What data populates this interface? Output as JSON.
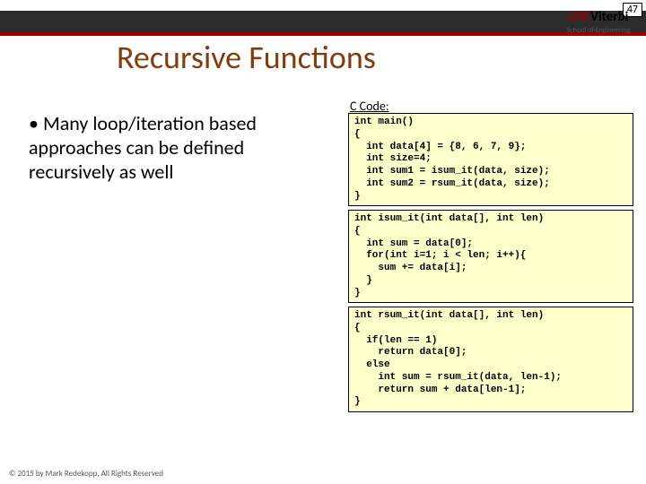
{
  "page_number": "47",
  "logo": {
    "usc": "USC",
    "viterbi": "Viterbi",
    "sub": "School of Engineering"
  },
  "title": "Recursive Functions",
  "bullet": "Many loop/iteration based approaches can be defined recursively as well",
  "code_label": "C Code:",
  "code1": "int main()\n{\n  int data[4] = {8, 6, 7, 9};\n  int size=4;\n  int sum1 = isum_it(data, size);\n  int sum2 = rsum_it(data, size);\n}",
  "code2": "int isum_it(int data[], int len)\n{\n  int sum = data[0];\n  for(int i=1; i < len; i++){\n    sum += data[i];\n  }\n}",
  "code3": "int rsum_it(int data[], int len)\n{\n  if(len == 1)\n    return data[0];\n  else\n    int sum = rsum_it(data, len-1);\n    return sum + data[len-1];\n}",
  "footer": "© 2015 by Mark Redekopp, All Rights Reserved"
}
